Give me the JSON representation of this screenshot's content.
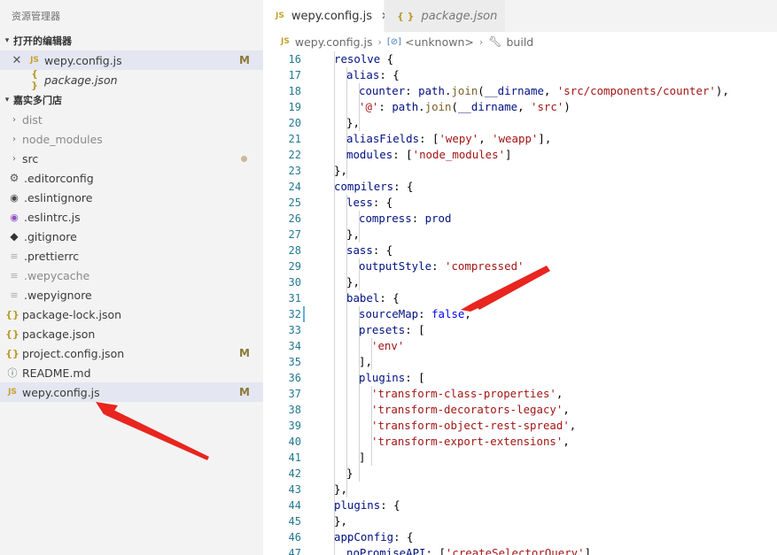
{
  "sidebar": {
    "title": "资源管理器",
    "open_editors": {
      "header": "打开的编辑器",
      "items": [
        {
          "label": "wepy.config.js",
          "icon": "JS",
          "status": "M"
        },
        {
          "label": "package.json",
          "icon": "{ }"
        }
      ]
    },
    "project": {
      "header": "嘉实多门店",
      "items": [
        {
          "label": "dist",
          "icon": "chevron-right-icon"
        },
        {
          "label": "node_modules",
          "icon": "chevron-right-icon"
        },
        {
          "label": "src",
          "icon": "chevron-right-icon"
        },
        {
          "label": ".editorconfig",
          "icon": "gear-icon"
        },
        {
          "label": ".eslintignore",
          "icon": "circle-icon"
        },
        {
          "label": ".eslintrc.js",
          "icon": "eslint-icon"
        },
        {
          "label": ".gitignore",
          "icon": "git-icon"
        },
        {
          "label": ".prettierrc",
          "icon": "lines-icon"
        },
        {
          "label": ".wepycache",
          "icon": "lines-icon"
        },
        {
          "label": ".wepyignore",
          "icon": "lines-icon"
        },
        {
          "label": "package-lock.json",
          "icon": "{}"
        },
        {
          "label": "package.json",
          "icon": "{}"
        },
        {
          "label": "project.config.json",
          "icon": "{}",
          "status": "M"
        },
        {
          "label": "README.md",
          "icon": "info-icon"
        },
        {
          "label": "wepy.config.js",
          "icon": "JS",
          "status": "M"
        }
      ]
    }
  },
  "tabs": [
    {
      "label": "wepy.config.js",
      "icon": "JS",
      "close": "✕"
    },
    {
      "label": "package.json",
      "icon": "{ }"
    }
  ],
  "breadcrumb": {
    "file": "wepy.config.js",
    "middle": "<unknown>",
    "last": "build",
    "js_icon": "JS",
    "bracket_icon": "[⊘]",
    "wrench_icon": "wrench-icon"
  },
  "code": {
    "line_numbers": [
      "16",
      "17",
      "18",
      "19",
      "20",
      "21",
      "22",
      "23",
      "24",
      "25",
      "26",
      "27",
      "28",
      "29",
      "30",
      "31",
      "32",
      "33",
      "34",
      "35",
      "36",
      "37",
      "38",
      "39",
      "40",
      "41",
      "42",
      "43",
      "44",
      "45",
      "46",
      "47"
    ],
    "lines": [
      {
        "i": 0,
        "t": [
          [
            "k",
            "resolve"
          ],
          [
            "",
            "："
          ],
          [
            "",
            ""
          ]
        ]
      },
      {
        "i": 0,
        "t": [
          [
            "k",
            "resolve"
          ],
          [
            "",
            " {"
          ]
        ]
      },
      {
        "i": 1,
        "t": [
          [
            "k",
            "alias"
          ],
          [
            "",
            ": {"
          ]
        ]
      },
      {
        "i": 2,
        "t": [
          [
            "k",
            "counter"
          ],
          [
            "",
            ": "
          ],
          [
            "k",
            "path"
          ],
          [
            "",
            "."
          ],
          [
            "f",
            "join"
          ],
          [
            "",
            "("
          ],
          [
            "k",
            "__dirname"
          ],
          [
            "",
            ", "
          ],
          [
            "s",
            "'src/components/counter'"
          ],
          [
            "",
            "),"
          ]
        ]
      },
      {
        "i": 2,
        "t": [
          [
            "s",
            "'@'"
          ],
          [
            "",
            ": "
          ],
          [
            "k",
            "path"
          ],
          [
            "",
            "."
          ],
          [
            "f",
            "join"
          ],
          [
            "",
            "("
          ],
          [
            "k",
            "__dirname"
          ],
          [
            "",
            ", "
          ],
          [
            "s",
            "'src'"
          ],
          [
            "",
            ")"
          ]
        ]
      },
      {
        "i": 1,
        "t": [
          [
            "",
            "},"
          ]
        ]
      },
      {
        "i": 1,
        "t": [
          [
            "k",
            "aliasFields"
          ],
          [
            "",
            ": ["
          ],
          [
            "s",
            "'wepy'"
          ],
          [
            "",
            ", "
          ],
          [
            "s",
            "'weapp'"
          ],
          [
            "",
            "],"
          ]
        ]
      },
      {
        "i": 1,
        "t": [
          [
            "k",
            "modules"
          ],
          [
            "",
            ": ["
          ],
          [
            "s",
            "'node_modules'"
          ],
          [
            "",
            "]"
          ]
        ]
      },
      {
        "i": 0,
        "t": [
          [
            "",
            "},"
          ]
        ]
      },
      {
        "i": 0,
        "t": [
          [
            "k",
            "compilers"
          ],
          [
            "",
            ": {"
          ]
        ]
      },
      {
        "i": 1,
        "t": [
          [
            "k",
            "less"
          ],
          [
            "",
            ": {"
          ]
        ]
      },
      {
        "i": 2,
        "t": [
          [
            "k",
            "compress"
          ],
          [
            "",
            ": "
          ],
          [
            "k",
            "prod"
          ]
        ]
      },
      {
        "i": 1,
        "t": [
          [
            "",
            "},"
          ]
        ]
      },
      {
        "i": 1,
        "t": [
          [
            "k",
            "sass"
          ],
          [
            "",
            ": {"
          ]
        ]
      },
      {
        "i": 2,
        "t": [
          [
            "k",
            "outputStyle"
          ],
          [
            "",
            ": "
          ],
          [
            "s",
            "'compressed'"
          ]
        ]
      },
      {
        "i": 1,
        "t": [
          [
            "",
            "},"
          ]
        ]
      },
      {
        "i": 1,
        "t": [
          [
            "k",
            "babel"
          ],
          [
            "",
            ": {"
          ]
        ]
      },
      {
        "i": 2,
        "t": [
          [
            "k",
            "sourceMap"
          ],
          [
            "",
            ": "
          ],
          [
            "b",
            "false"
          ],
          [
            "",
            ","
          ]
        ]
      },
      {
        "i": 2,
        "t": [
          [
            "k",
            "presets"
          ],
          [
            "",
            ": ["
          ]
        ]
      },
      {
        "i": 3,
        "t": [
          [
            "s",
            "'env'"
          ]
        ]
      },
      {
        "i": 2,
        "t": [
          [
            "",
            "],"
          ]
        ]
      },
      {
        "i": 2,
        "t": [
          [
            "k",
            "plugins"
          ],
          [
            "",
            ": ["
          ]
        ]
      },
      {
        "i": 3,
        "t": [
          [
            "s",
            "'transform-class-properties'"
          ],
          [
            "",
            ","
          ]
        ]
      },
      {
        "i": 3,
        "t": [
          [
            "s",
            "'transform-decorators-legacy'"
          ],
          [
            "",
            ","
          ]
        ]
      },
      {
        "i": 3,
        "t": [
          [
            "s",
            "'transform-object-rest-spread'"
          ],
          [
            "",
            ","
          ]
        ]
      },
      {
        "i": 3,
        "t": [
          [
            "s",
            "'transform-export-extensions'"
          ],
          [
            "",
            ","
          ]
        ]
      },
      {
        "i": 2,
        "t": [
          [
            "",
            "]"
          ]
        ]
      },
      {
        "i": 1,
        "t": [
          [
            "",
            "}"
          ]
        ]
      },
      {
        "i": 0,
        "t": [
          [
            "",
            "},"
          ]
        ]
      },
      {
        "i": 0,
        "t": [
          [
            "k",
            "plugins"
          ],
          [
            "",
            ": {"
          ]
        ]
      },
      {
        "i": 0,
        "t": [
          [
            "",
            "},"
          ]
        ]
      },
      {
        "i": 0,
        "t": [
          [
            "k",
            "appConfig"
          ],
          [
            "",
            ": {"
          ]
        ]
      },
      {
        "i": 1,
        "t": [
          [
            "k",
            "noPromiseAPI"
          ],
          [
            "",
            ": ["
          ],
          [
            "s",
            "'createSelectorQuery'"
          ],
          [
            "",
            "]"
          ]
        ]
      }
    ]
  },
  "annotations": {
    "arrow_color": "#e8251f"
  }
}
